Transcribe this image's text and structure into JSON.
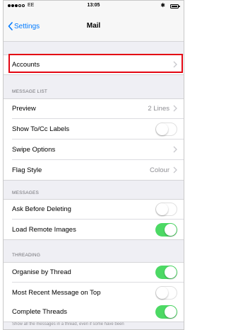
{
  "status": {
    "carrier": "EE",
    "time": "13:05"
  },
  "nav": {
    "back_label": "Settings",
    "title": "Mail"
  },
  "accounts": {
    "label": "Accounts"
  },
  "message_list": {
    "header": "MESSAGE LIST",
    "preview": {
      "label": "Preview",
      "value": "2 Lines"
    },
    "show_to_cc": {
      "label": "Show To/Cc Labels",
      "on": false
    },
    "swipe_options": {
      "label": "Swipe Options"
    },
    "flag_style": {
      "label": "Flag Style",
      "value": "Colour"
    }
  },
  "messages": {
    "header": "MESSAGES",
    "ask_before_deleting": {
      "label": "Ask Before Deleting",
      "on": false
    },
    "load_remote_images": {
      "label": "Load Remote Images",
      "on": true
    }
  },
  "threading": {
    "header": "THREADING",
    "organise_by_thread": {
      "label": "Organise by Thread",
      "on": true
    },
    "most_recent_on_top": {
      "label": "Most Recent Message on Top",
      "on": false
    },
    "complete_threads": {
      "label": "Complete Threads",
      "on": true
    },
    "footer_text": "Show all the messages in a thread, even if some have been"
  },
  "colors": {
    "accent": "#007aff",
    "toggle_on": "#4cd964",
    "highlight": "#e30613"
  }
}
